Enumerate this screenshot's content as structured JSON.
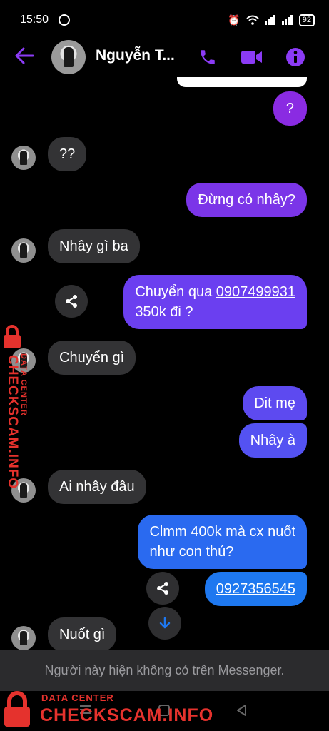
{
  "status_bar": {
    "time": "15:50",
    "battery": "92"
  },
  "header": {
    "contact_name": "Nguyễn T..."
  },
  "messages": [
    {
      "side": "out",
      "text": "?"
    },
    {
      "side": "in",
      "text": "??"
    },
    {
      "side": "out",
      "text": "Đừng có nhây?"
    },
    {
      "side": "in",
      "text": "Nhây gì ba"
    },
    {
      "side": "out",
      "line1_prefix": "Chuyển qua ",
      "phone": "0907499931",
      "line2": "350k đi ?"
    },
    {
      "side": "in",
      "text": "Chuyển gì"
    },
    {
      "side": "out",
      "text": "Dit mẹ"
    },
    {
      "side": "out",
      "text": "Nhây à"
    },
    {
      "side": "in",
      "text": "Ai nhây đâu"
    },
    {
      "side": "out",
      "line1": "Clmm 400k mà cx nuốt",
      "line2": "như con thú?"
    },
    {
      "side": "out",
      "phone": "0927356545"
    },
    {
      "side": "in",
      "text": "Nuốt gì"
    }
  ],
  "notice": "Người này hiện không có trên Messenger.",
  "watermark": {
    "small": "DATA CENTER",
    "big": "CHECKSCAM.INFO"
  },
  "colors": {
    "accent": "#8b3bf5",
    "bubble_out_purple": "#7c3aed",
    "bubble_out_blue": "#1e78f0",
    "bubble_in": "#333335",
    "watermark": "#e5322d"
  }
}
